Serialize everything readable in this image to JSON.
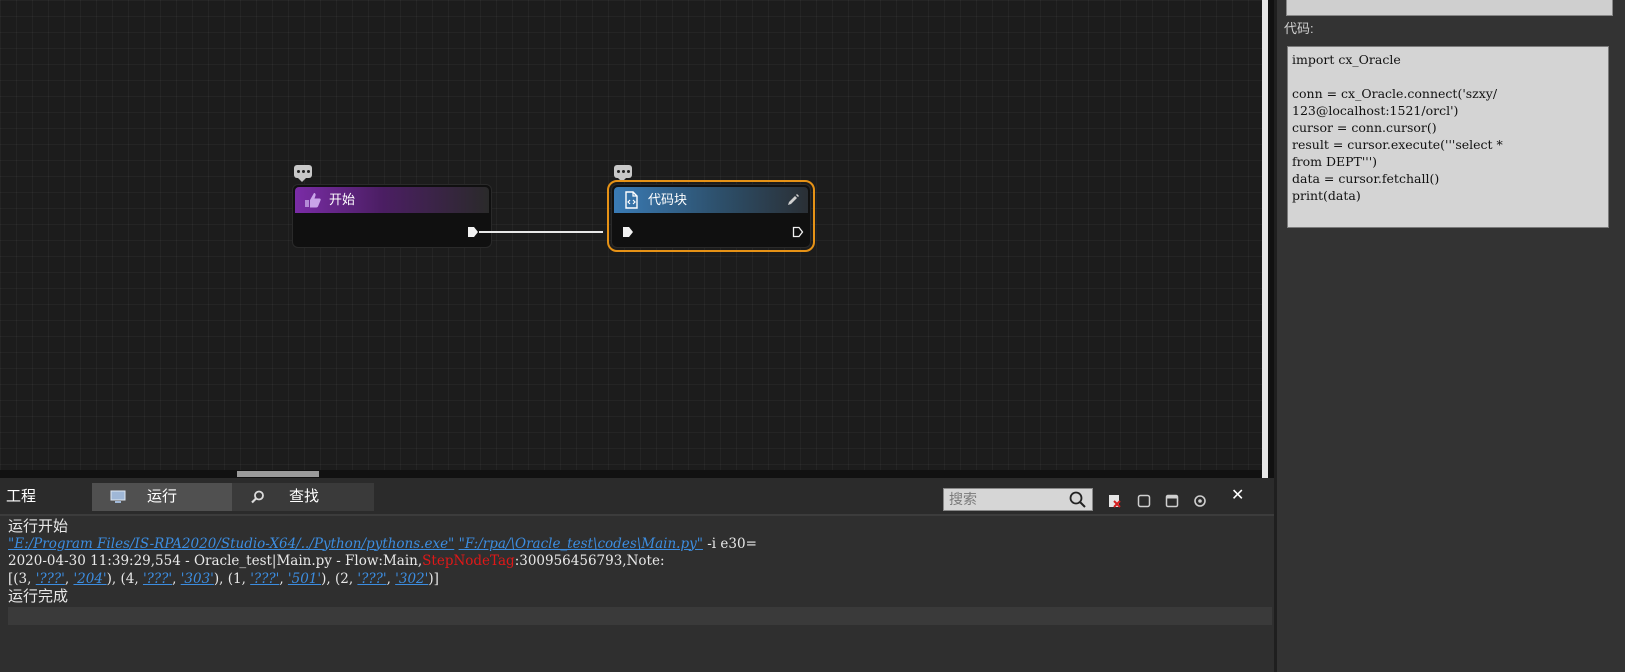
{
  "flow": {
    "start_node": {
      "title": "开始"
    },
    "code_node": {
      "title": "代码块"
    }
  },
  "properties": {
    "code_label": "代码:",
    "code_text": "import cx_Oracle\n\nconn = cx_Oracle.connect('szxy/\n123@localhost:1521/orcl')\ncursor = conn.cursor()\nresult = cursor.execute('''select *\nfrom DEPT''')\ndata = cursor.fetchall()\nprint(data)"
  },
  "bottom_panel": {
    "tabs": [
      {
        "label": "工程"
      },
      {
        "label": "运行"
      },
      {
        "label": "查找"
      }
    ],
    "search_placeholder": "搜索",
    "close": "✕",
    "console": {
      "line1": "运行开始",
      "line2_path1": "\"E:/Program Files/IS-RPA2020/Studio-X64/../Python/pythons.exe\"",
      "line2_sep": " ",
      "line2_path2": "\"F:/rpa/\\Oracle_test\\codes\\Main.py\"",
      "line2_args": " -i e30=",
      "line3_a": "2020-04-30 11:39:29,554 - Oracle_test|Main.py - Flow:Main,",
      "line3_tag": "StepNodeTag",
      "line3_b": ":300956456793,Note:",
      "line4": {
        "open": "[(3, ",
        "v1": "'???'",
        "c1": ", ",
        "v2": "'204'",
        "c2": "), (4, ",
        "v3": "'???'",
        "c3": ", ",
        "v4": "'303'",
        "c4": "), (1, ",
        "v5": "'???'",
        "c5": ", ",
        "v6": "'501'",
        "c6": "), (2, ",
        "v7": "'???'",
        "c7": ", ",
        "v8": "'302'",
        "close": ")]"
      },
      "line5": "运行完成"
    }
  },
  "icons": {
    "start": "pointing-hand-icon",
    "code": "code-file-icon",
    "edit": "pencil-icon",
    "comment": "comment-icon",
    "run_tab": "monitor-icon",
    "find_tab": "magnifier-icon",
    "search": "search-icon"
  },
  "colors": {
    "selection": "#e69216",
    "link": "#3c8de0",
    "tag_red": "#e01818",
    "start_header": "#7a2ca6",
    "code_header": "#3a7bb5"
  }
}
